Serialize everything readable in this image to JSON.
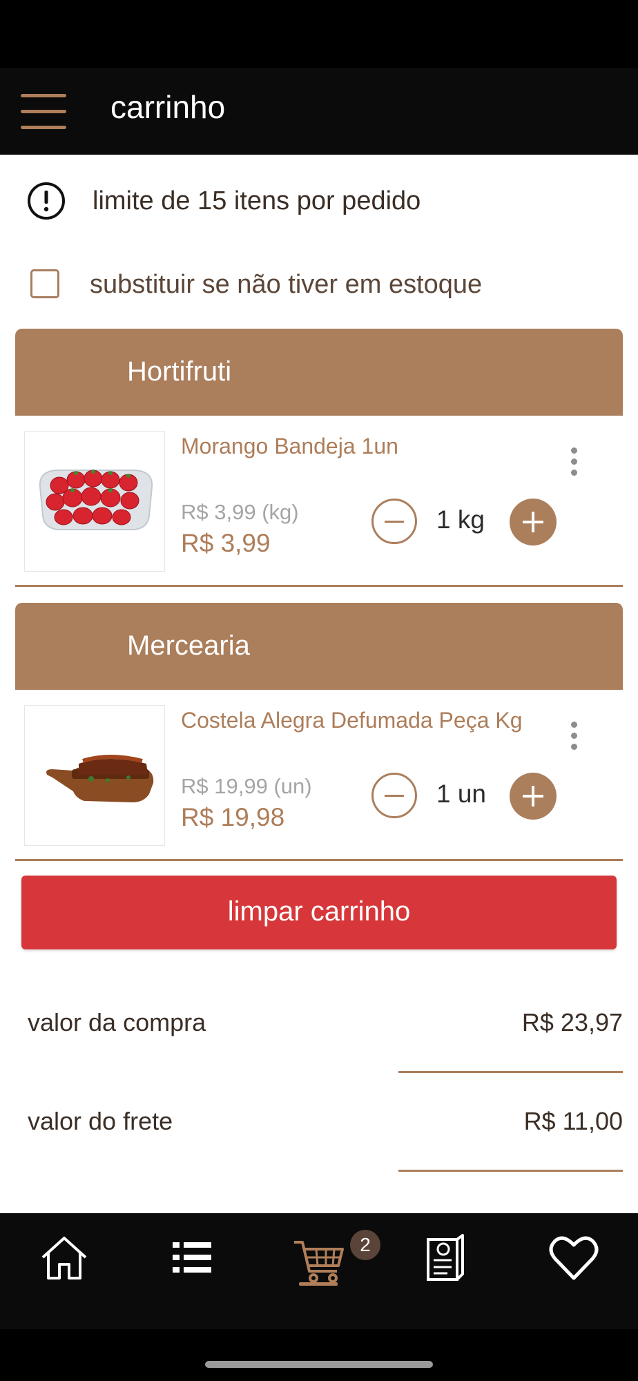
{
  "header": {
    "title": "carrinho"
  },
  "notice": {
    "text": "limite de 15 itens por pedido"
  },
  "substitute": {
    "label": "substituir se não tiver em estoque",
    "checked": false
  },
  "categories": [
    {
      "title": "Hortifruti",
      "items": [
        {
          "name": "Morango Bandeja 1un",
          "unit_price": "R$ 3,99 (kg)",
          "price": "R$ 3,99",
          "quantity": "1 kg"
        }
      ]
    },
    {
      "title": "Mercearia",
      "items": [
        {
          "name": "Costela Alegra Defumada Peça Kg",
          "unit_price": "R$ 19,99 (un)",
          "price": "R$ 19,98",
          "quantity": "1 un"
        }
      ]
    }
  ],
  "clear_button": {
    "label": "limpar carrinho"
  },
  "summary": {
    "purchase_label": "valor da compra",
    "purchase_value": "R$ 23,97",
    "shipping_label": "valor do frete",
    "shipping_value": "R$ 11,00"
  },
  "nav": {
    "items": [
      "home-icon",
      "list-icon",
      "cart-icon",
      "orders-icon",
      "heart-icon"
    ],
    "cart_badge": "2",
    "active": "cart"
  },
  "colors": {
    "accent": "#ab7e5c",
    "danger": "#d7373a",
    "nav_bg": "#0b0b0b"
  }
}
